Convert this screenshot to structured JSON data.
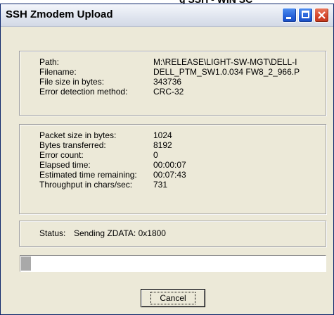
{
  "window": {
    "title": "SSH Zmodem Upload",
    "title_bar_color": "#dfe4ee",
    "controls": {
      "minimize": "minimize-icon",
      "maximize": "maximize-icon",
      "close": "close-icon"
    }
  },
  "file_info": {
    "path_label": "Path:",
    "path_value": "M:\\RELEASE\\LIGHT-SW-MGT\\DELL-I",
    "filename_label": "Filename:",
    "filename_value": "DELL_PTM_SW1.0.034 FW8_2_966.P",
    "size_label": "File size in bytes:",
    "size_value": "343736",
    "error_method_label": "Error detection method:",
    "error_method_value": "CRC-32"
  },
  "transfer": {
    "packet_label": "Packet size in bytes:",
    "packet_value": "1024",
    "transferred_label": "Bytes transferred:",
    "transferred_value": "8192",
    "errors_label": "Error count:",
    "errors_value": "0",
    "elapsed_label": "Elapsed time:",
    "elapsed_value": "00:00:07",
    "remaining_label": "Estimated time remaining:",
    "remaining_value": "00:07:43",
    "throughput_label": "Throughput in chars/sec:",
    "throughput_value": "731"
  },
  "status": {
    "label": "Status:",
    "value": "Sending ZDATA: 0x1800"
  },
  "progress": {
    "fraction": 0.024
  },
  "actions": {
    "cancel_label": "Cancel"
  }
}
